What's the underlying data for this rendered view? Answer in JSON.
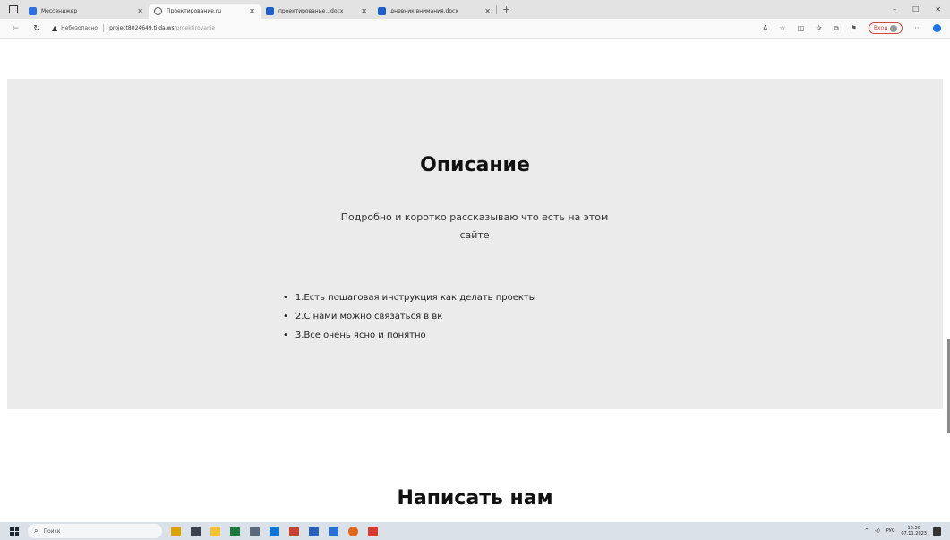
{
  "browser": {
    "tabs": [
      {
        "label": "Мессенджер",
        "icon": "messenger-icon",
        "active": false
      },
      {
        "label": "Проектирование.ru",
        "icon": "globe-icon",
        "active": true
      },
      {
        "label": "проектирование...docx",
        "icon": "word-doc-icon",
        "active": false
      },
      {
        "label": "дневник внимания.docx",
        "icon": "word-doc-icon",
        "active": false
      }
    ],
    "new_tab": "+",
    "window_controls": {
      "minimize": "–",
      "maximize": "☐",
      "close": "✕"
    },
    "address": {
      "security_label": "Небезопасно",
      "host": "project8024649.tilda.ws",
      "path": "/proektirovanie"
    },
    "profile_label": "Вход"
  },
  "page": {
    "section1": {
      "title": "Описание",
      "description": "Подробно и коротко рассказываю что есть на этом сайте",
      "features": [
        "1.Есть пошаговая инструкция как делать проекты",
        "2.С нами можно связаться в вк",
        "3.Все очень ясно и понятно"
      ]
    },
    "section2": {
      "title": "Написать нам"
    }
  },
  "taskbar": {
    "search_placeholder": "Поиск",
    "tray": {
      "language": "РУС",
      "time": "18:50",
      "date": "07.11.2023"
    }
  },
  "colors": {
    "section_bg": "#ebebeb",
    "taskbar_bg": "#dbe1e8",
    "accent_profile": "#d4473d"
  }
}
